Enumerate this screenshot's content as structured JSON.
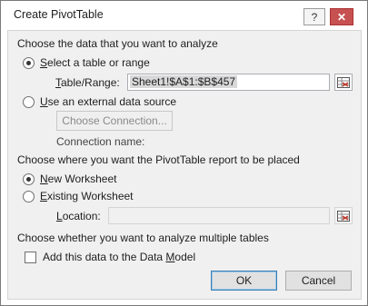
{
  "dialog": {
    "title": "Create PivotTable",
    "help_label": "?",
    "close_label": "✕"
  },
  "data_section": {
    "heading": "Choose the data that you want to analyze",
    "select_range_label": "elect a table or range",
    "select_range_underline": "S",
    "table_range_label": "able/Range:",
    "table_range_underline": "T",
    "table_range_value": "Sheet1!$A$1:$B$457",
    "external_label": "se an external data source",
    "external_underline": "U",
    "choose_connection_label": "Choose Connection...",
    "connection_name_label": "Connection name:"
  },
  "placement_section": {
    "heading": "Choose where you want the PivotTable report to be placed",
    "new_ws_label": "ew Worksheet",
    "new_ws_underline": "N",
    "existing_ws_label": "xisting Worksheet",
    "existing_ws_underline": "E",
    "location_label": "ocation:",
    "location_underline": "L",
    "location_value": ""
  },
  "multiple_section": {
    "heading": "Choose whether you want to analyze multiple tables",
    "data_model_label_pre": "Add this data to the Data ",
    "data_model_underline": "M",
    "data_model_label_post": "odel",
    "data_model_checked": "false"
  },
  "buttons": {
    "ok": "OK",
    "cancel": "Cancel"
  },
  "selection": {
    "data_source": "table_or_range",
    "placement": "new_worksheet"
  }
}
